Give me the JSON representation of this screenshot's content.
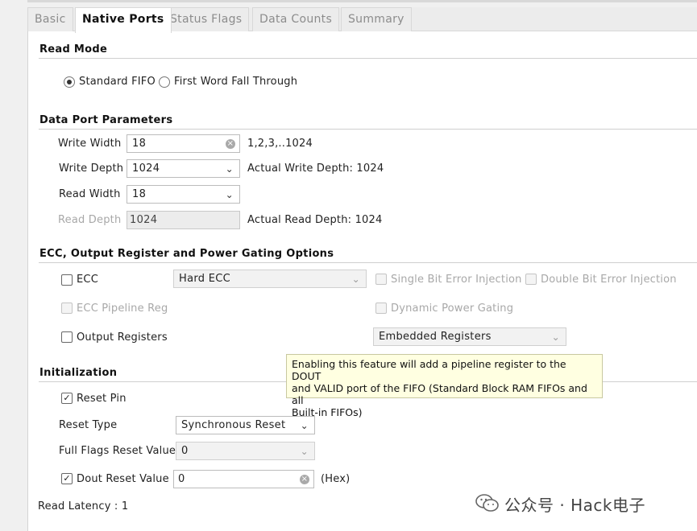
{
  "tabs": [
    "Basic",
    "Native Ports",
    "Status Flags",
    "Data Counts",
    "Summary"
  ],
  "read_mode": {
    "title": "Read Mode",
    "options": [
      "Standard FIFO",
      "First Word Fall Through"
    ],
    "selected": "Standard FIFO"
  },
  "data_port": {
    "title": "Data Port Parameters",
    "write_width_label": "Write Width",
    "write_width_value": "18",
    "write_width_range": "1,2,3,..1024",
    "write_depth_label": "Write Depth",
    "write_depth_value": "1024",
    "actual_write_depth": "Actual Write Depth: 1024",
    "read_width_label": "Read Width",
    "read_width_value": "18",
    "read_depth_label": "Read Depth",
    "read_depth_value": "1024",
    "actual_read_depth": "Actual Read Depth: 1024"
  },
  "ecc": {
    "title": "ECC, Output Register and Power Gating Options",
    "ecc_label": "ECC",
    "ecc_type_value": "Hard ECC",
    "single_bit_label": "Single Bit Error Injection",
    "double_bit_label": "Double Bit Error Injection",
    "ecc_pipeline_label": "ECC Pipeline Reg",
    "dynamic_power_label": "Dynamic Power Gating",
    "output_registers_label": "Output Registers",
    "output_registers_value": "Embedded Registers"
  },
  "tooltip": {
    "line1": "Enabling this feature will add a pipeline register to the DOUT",
    "line2": "and VALID port of the FIFO (Standard Block RAM FIFOs and all",
    "line3": "Built-in FIFOs)"
  },
  "init": {
    "title": "Initialization",
    "reset_pin_label": "Reset Pin",
    "reset_pin_checked": true,
    "reset_type_label": "Reset Type",
    "reset_type_value": "Synchronous Reset",
    "full_flags_label": "Full Flags Reset Value",
    "full_flags_value": "0",
    "dout_reset_label": "Dout Reset Value",
    "dout_reset_checked": true,
    "dout_reset_value": "0",
    "dout_reset_unit": "(Hex)"
  },
  "read_latency": "Read Latency : 1",
  "watermark": "公众号 · Hack电子"
}
